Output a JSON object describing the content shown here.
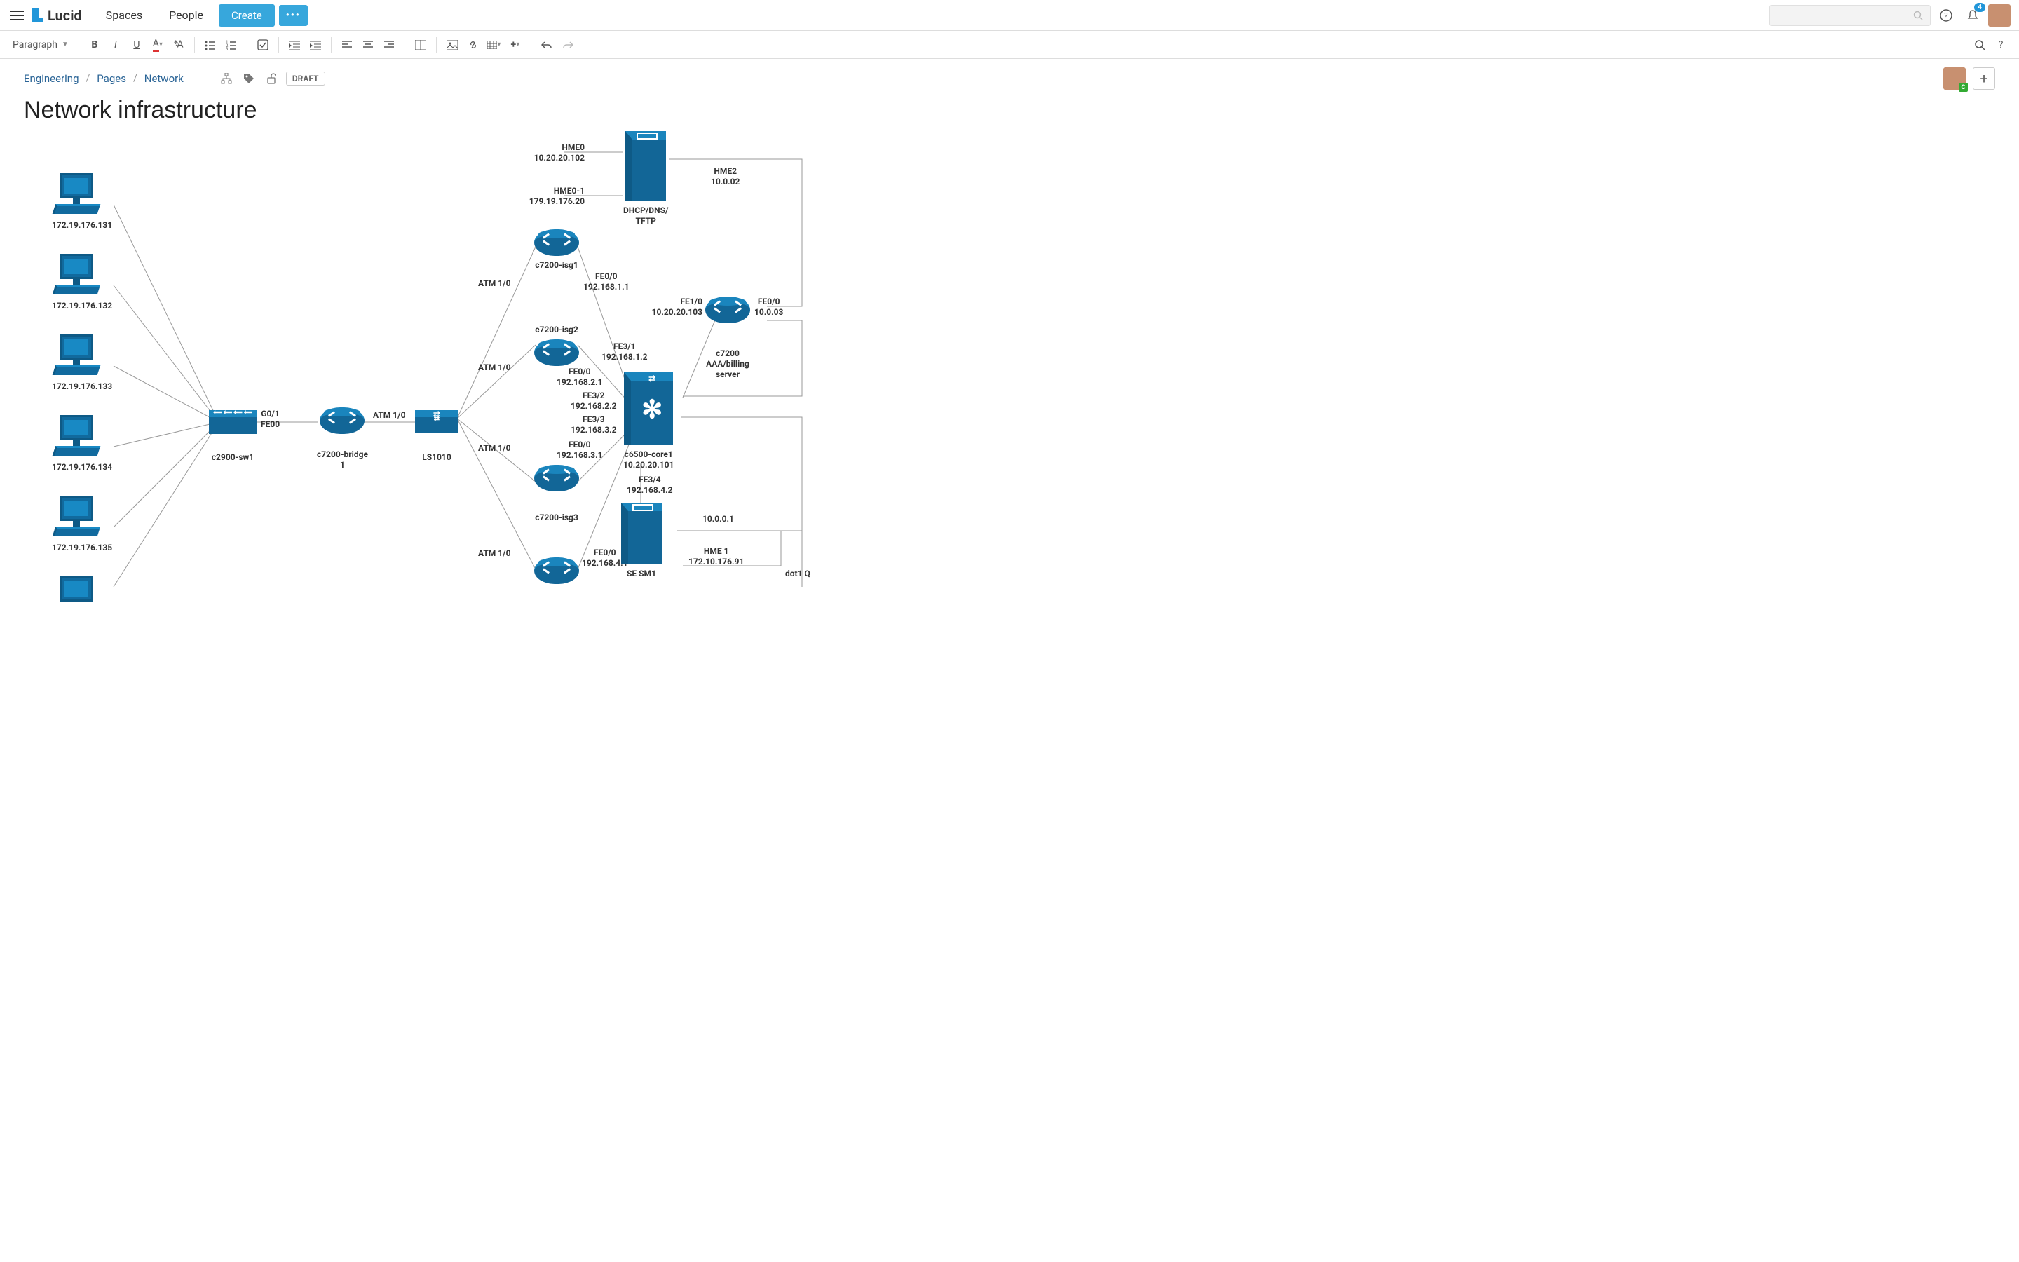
{
  "topbar": {
    "brand": "Lucid",
    "links": [
      "Spaces",
      "People"
    ],
    "create": "Create",
    "more": "•••",
    "notif_count": "4"
  },
  "toolbar": {
    "para": "Paragraph"
  },
  "breadcrumb": [
    "Engineering",
    "Pages",
    "Network"
  ],
  "status": "DRAFT",
  "title": "Network infrastructure",
  "workstations": [
    "172.19.176.131",
    "172.19.176.132",
    "172.19.176.133",
    "172.19.176.134",
    "172.19.176.135"
  ],
  "nodes": {
    "sw1": "c2900-sw1",
    "bridge": "c7200-bridge\n1",
    "ls": "LS1010",
    "isg1": "c7200-isg1",
    "isg2": "c7200-isg2",
    "isg3": "c7200-isg3",
    "dhcp": "DHCP/DNS/\nTFTP",
    "aaa": "c7200\nAAA/billing\nserver",
    "core": "c6500-core1\n10.20.20.101",
    "sesm": "SE SM1"
  },
  "labels": {
    "g01_fe00": "G0/1\nFE00",
    "atm_bridge_out": "ATM 1/0",
    "atm_1": "ATM 1/0",
    "atm_2": "ATM 1/0",
    "atm_3": "ATM 1/0",
    "atm_4": "ATM 1/0",
    "hme0": "HME0\n10.20.20.102",
    "hme01": "HME0-1\n179.19.176.20",
    "hme2": "HME2\n10.0.02",
    "fe00_1": "FE0/0\n192.168.1.1",
    "fe10": "FE1/0\n10.20.20.103",
    "fe00_r": "FE0/0\n10.0.03",
    "fe31": "FE3/1\n192.168.1.2",
    "fe00_2": "FE0/0\n192.168.2.1",
    "fe32": "FE3/2\n192.168.2.2",
    "fe33": "FE3/3\n192.168.3.2",
    "fe00_3": "FE0/0\n192.168.3.1",
    "fe34": "FE3/4\n192.168.4.2",
    "fe00_4": "FE0/0\n192.168.4.1",
    "ip1": "10.0.0.1",
    "hme1_b": "HME 1\n172.10.176.91",
    "dot1q": "dot1 Q"
  }
}
